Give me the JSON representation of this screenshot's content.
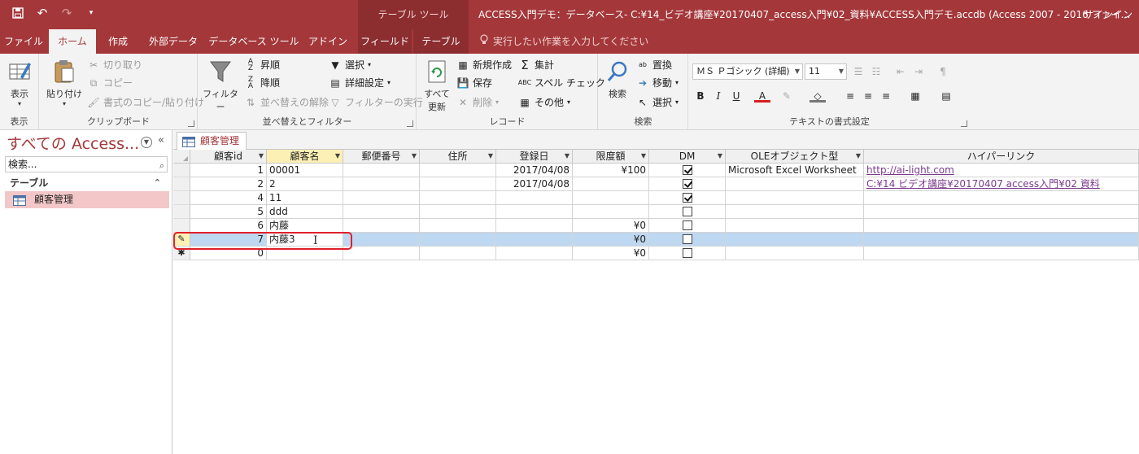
{
  "window": {
    "contextual_tab": "テーブル ツール",
    "title": "ACCESS入門デモ：データベース- C:¥14_ビデオ講座¥20170407_access入門¥02_資料¥ACCESS入門デモ.accdb (Access 2007 - 2016 ファイ…",
    "signin": "サインイン"
  },
  "ribbon_tabs": [
    "ファイル",
    "ホーム",
    "作成",
    "外部データ",
    "データベース ツール",
    "アドイン",
    "フィールド",
    "テーブル"
  ],
  "tell_me": "実行したい作業を入力してください",
  "groups": {
    "view": {
      "label": "表示",
      "btn": "表示"
    },
    "clipboard": {
      "label": "クリップボード",
      "paste": "貼り付け",
      "cut": "切り取り",
      "copy": "コピー",
      "format_painter": "書式のコピー/貼り付け"
    },
    "sort": {
      "label": "並べ替えとフィルター",
      "filter": "フィルター",
      "asc": "昇順",
      "desc": "降順",
      "remove_sort": "並べ替えの解除",
      "selection": "選択",
      "advanced": "詳細設定",
      "toggle_filter": "フィルターの実行"
    },
    "records": {
      "label": "レコード",
      "refresh_line1": "すべて",
      "refresh_line2": "更新",
      "new": "新規作成",
      "save": "保存",
      "delete": "削除",
      "totals": "集計",
      "spelling": "スペル チェック",
      "more": "その他"
    },
    "find": {
      "label": "検索",
      "find": "検索",
      "replace": "置換",
      "goto": "移動",
      "select": "選択"
    },
    "text": {
      "label": "テキストの書式設定",
      "font": "ＭＳ Ｐゴシック (詳細)",
      "size": "11"
    }
  },
  "nav": {
    "header": "すべての Access...",
    "search_placeholder": "検索...",
    "category": "テーブル",
    "item": "顧客管理"
  },
  "doc_tab": "顧客管理",
  "columns": [
    "顧客id",
    "顧客名",
    "郵便番号",
    "住所",
    "登録日",
    "限度額",
    "DM",
    "OLEオブジェクト型",
    "ハイパーリンク"
  ],
  "rows": [
    {
      "id": "1",
      "name": "00001",
      "zip": "",
      "addr": "",
      "date": "2017/04/08",
      "limit": "¥100",
      "dm": true,
      "ole": "Microsoft Excel Worksheet",
      "link": "http://ai-light.com"
    },
    {
      "id": "2",
      "name": "2",
      "zip": "",
      "addr": "",
      "date": "2017/04/08",
      "limit": "",
      "dm": true,
      "ole": "",
      "link": "C:¥14 ビデオ講座¥20170407 access入門¥02 資料"
    },
    {
      "id": "4",
      "name": "11",
      "zip": "",
      "addr": "",
      "date": "",
      "limit": "",
      "dm": true,
      "ole": "",
      "link": ""
    },
    {
      "id": "5",
      "name": "ddd",
      "zip": "",
      "addr": "",
      "date": "",
      "limit": "",
      "dm": false,
      "ole": "",
      "link": ""
    },
    {
      "id": "6",
      "name": "内藤",
      "zip": "",
      "addr": "",
      "date": "",
      "limit": "¥0",
      "dm": false,
      "ole": "",
      "link": ""
    },
    {
      "id": "7",
      "name": "内藤3",
      "zip": "",
      "addr": "",
      "date": "",
      "limit": "¥0",
      "dm": false,
      "ole": "",
      "link": ""
    },
    {
      "id": "0",
      "name": "",
      "zip": "",
      "addr": "",
      "date": "",
      "limit": "¥0",
      "dm": false,
      "ole": "",
      "link": ""
    }
  ],
  "colors": {
    "accent": "#a4373a",
    "active_row": "#bfd8f1",
    "selected_header": "#fcf0b4"
  }
}
